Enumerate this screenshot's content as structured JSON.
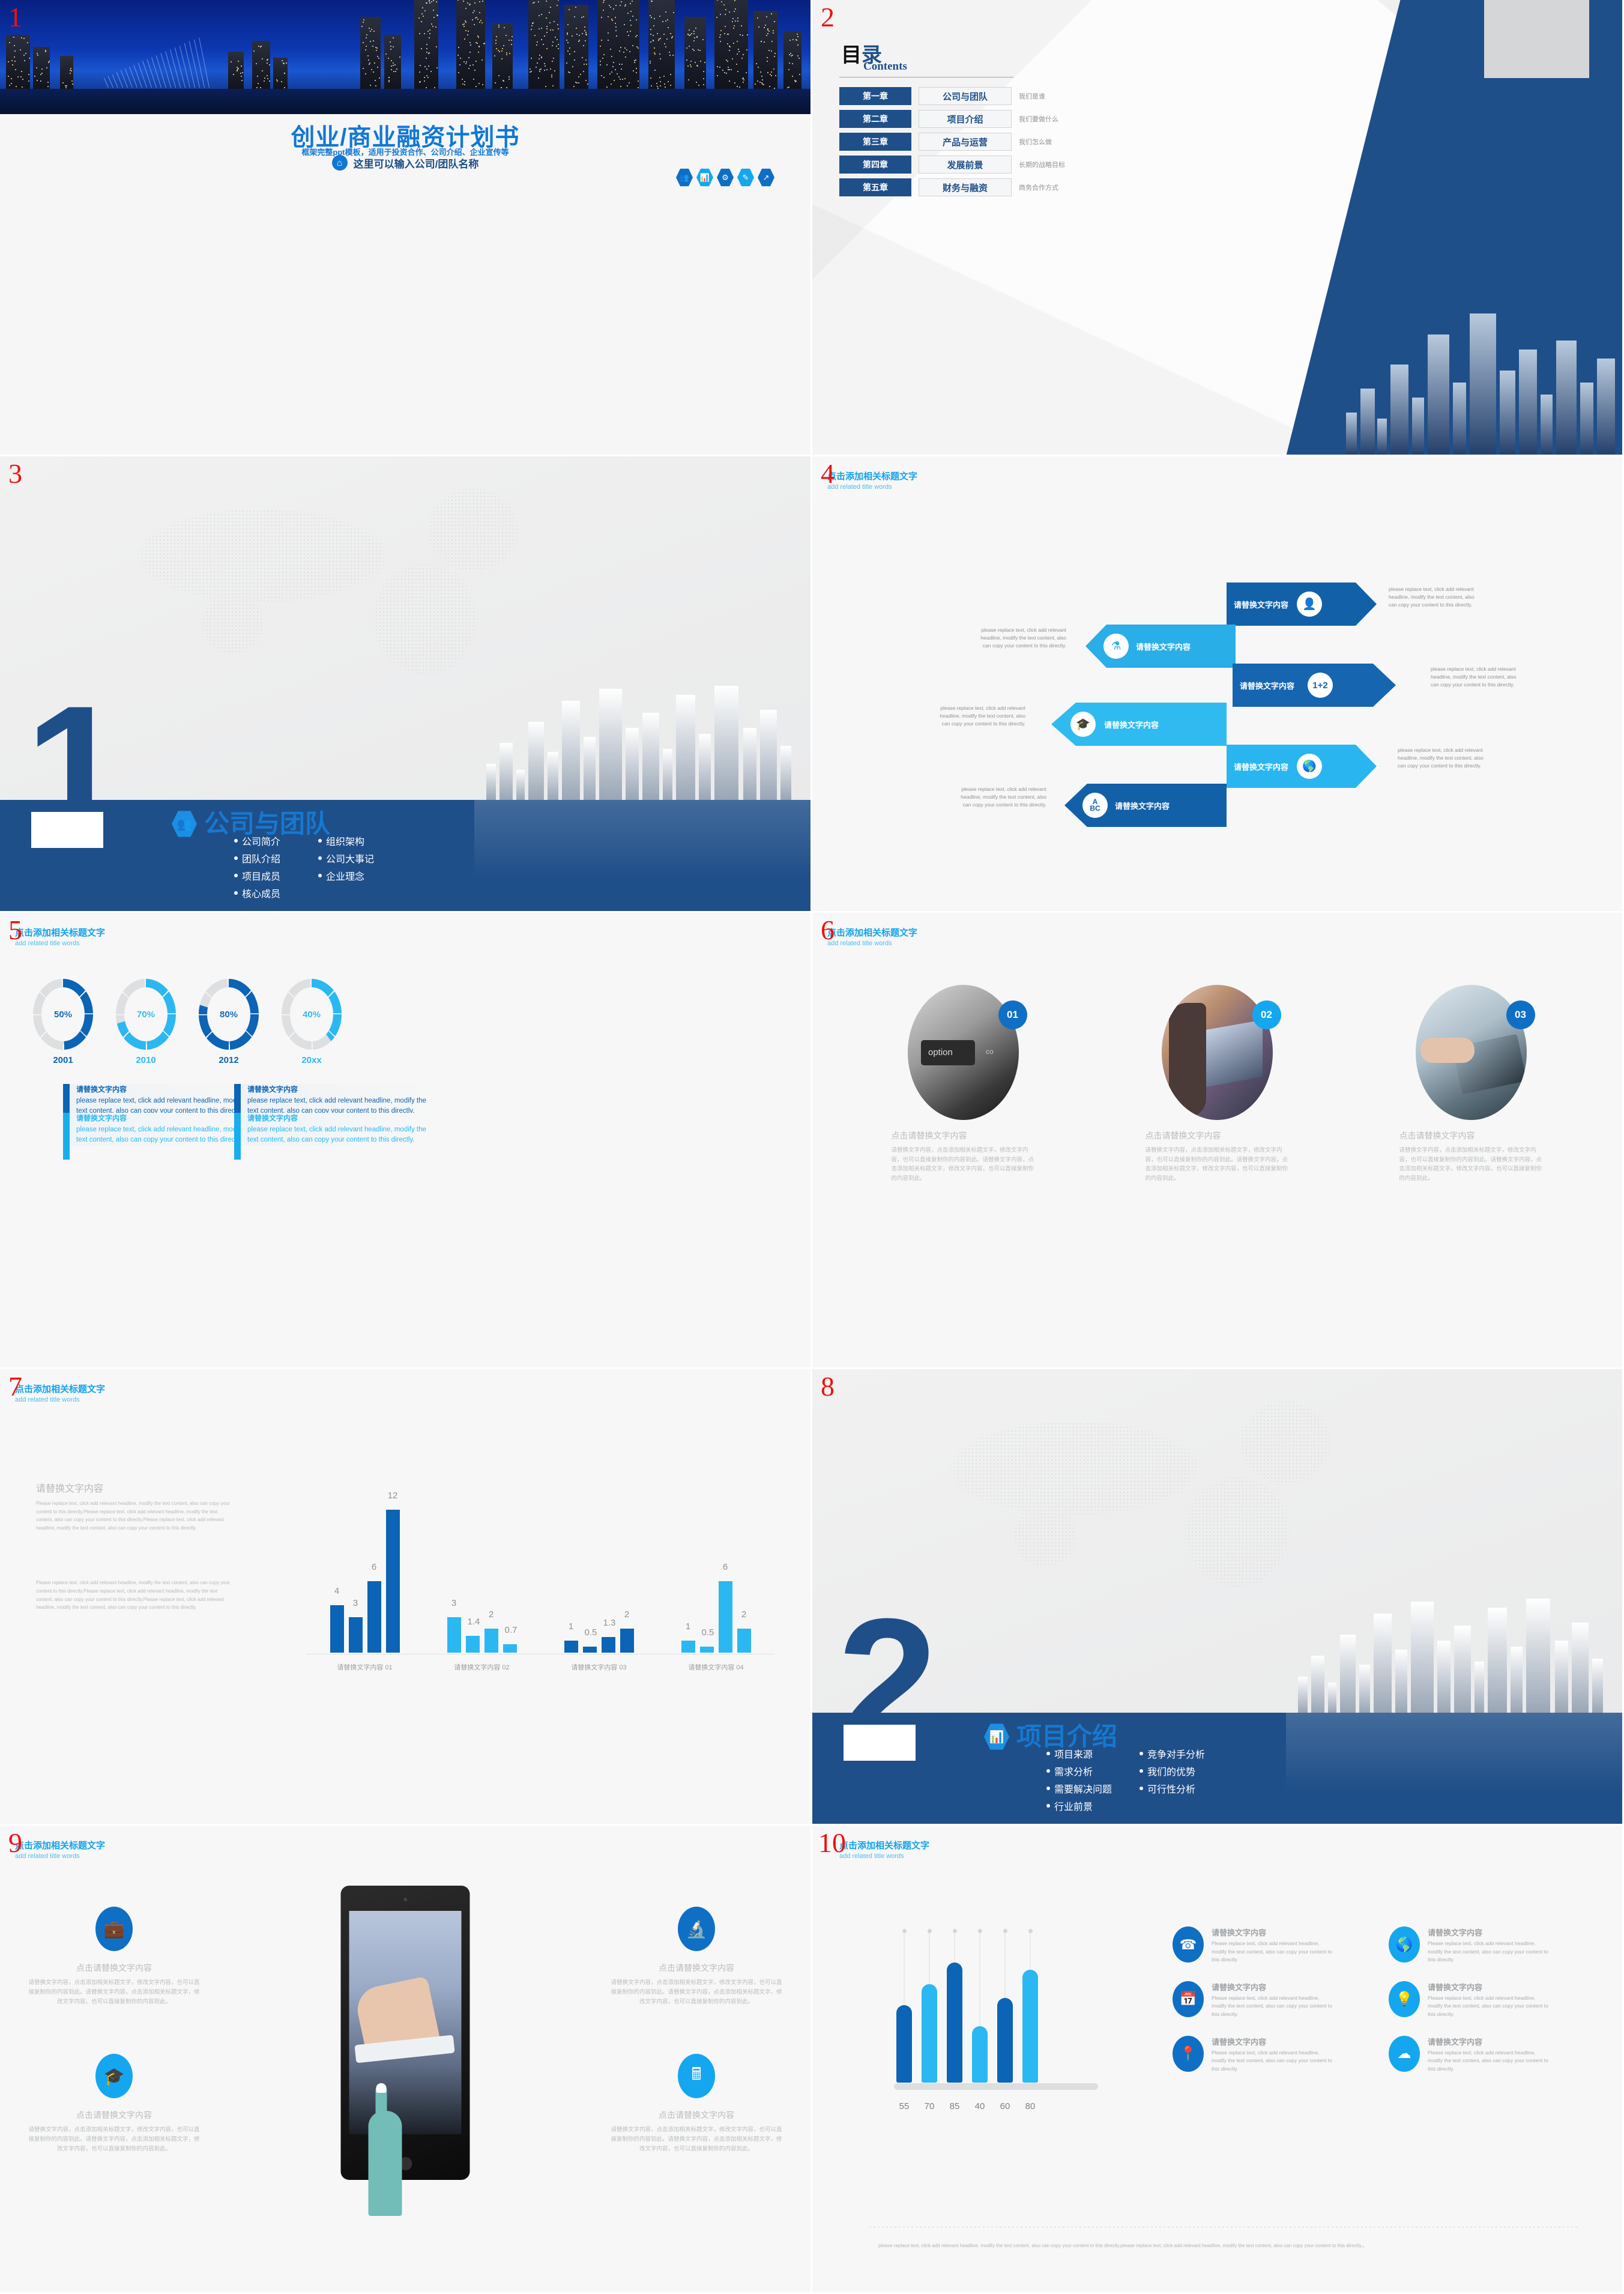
{
  "colors": {
    "dark_blue": "#1f4f89",
    "mid_blue": "#0d6fc4",
    "light_blue": "#14a7ef",
    "accent_cyan": "#13a3ea",
    "slide_number_red": "#ee1111",
    "grey_text": "#b9bcbf"
  },
  "slides": [
    {
      "number": "1",
      "title": "创业/商业融资计划书",
      "subtitle": "框架完整ppt模板，适用于投资合作、公司介绍、企业宣传等",
      "org_placeholder": "这里可以输入公司/团队名称",
      "home_icon": "home-icon",
      "hex_icons": [
        "people-group-icon",
        "presentation-chart-icon",
        "gear-person-icon",
        "document-pen-icon",
        "growth-arrow-icon"
      ]
    },
    {
      "number": "2",
      "heading_cn": "目录",
      "heading_cn_black": "目",
      "heading_cn_blue": "录",
      "heading_en": "Contents",
      "rows": [
        {
          "chapter": "第一章",
          "name": "公司与团队",
          "note": "我们是谁"
        },
        {
          "chapter": "第二章",
          "name": "项目介绍",
          "note": "我们要做什么"
        },
        {
          "chapter": "第三章",
          "name": "产品与运营",
          "note": "我们怎么做"
        },
        {
          "chapter": "第四章",
          "name": "发展前景",
          "note": "长期的战略目标"
        },
        {
          "chapter": "第五章",
          "name": "财务与融资",
          "note": "商务合作方式"
        }
      ]
    },
    {
      "number": "3",
      "big_number": "1",
      "hex_icon": "people-group-icon",
      "section_title": "公司与团队",
      "bullets": [
        "公司简介",
        "组织架构",
        "团队介绍",
        "公司大事记",
        "项目成员",
        "企业理念",
        "核心成员"
      ]
    },
    {
      "number": "4",
      "title_cn": "点击添加相关标题文字",
      "title_en": "add related title words",
      "arrows": [
        {
          "side": "right",
          "color": "#1260a8",
          "label": "请替换文字内容",
          "icon": "person-icon",
          "text": "please replace text, click add relevant headline, modify the text content, also can copy your content to this directly."
        },
        {
          "side": "left",
          "color": "#2aaee8",
          "label": "请替换文字内容",
          "icon": "flask-icon",
          "text": "please replace text, click add relevant headline, modify the text content, also can copy your content to this directly."
        },
        {
          "side": "right",
          "color": "#1565b0",
          "label": "请替换文字内容",
          "icon": "1+2-math-icon",
          "text": "please replace text, click add relevant headline, modify the text content, also can copy your content to this directly."
        },
        {
          "side": "left",
          "color": "#2fbbf0",
          "label": "请替换文字内容",
          "icon": "graduation-cap-icon",
          "text": "please replace text, click add relevant headline, modify the text content, also can copy your content to this directly."
        },
        {
          "side": "right",
          "color": "#29b6f0",
          "label": "请替换文字内容",
          "icon": "globe-trophy-icon",
          "text": "please replace text, click add relevant headline, modify the text content, also can copy your content to this directly."
        },
        {
          "side": "left",
          "color": "#1260a8",
          "label": "请替换文字内容",
          "icon": "abc-icon",
          "text": "please replace text, click add relevant headline, modify the text content, also can copy your content to this directly."
        }
      ]
    },
    {
      "number": "5",
      "title_cn": "点击添加相关标题文字",
      "title_en": "add related title words",
      "text_blocks": [
        {
          "heading": "请替换文字内容",
          "body": "please replace text, click add relevant headline, modify the text content, also can copy your content to this directly.",
          "color": "#0b64b5"
        },
        {
          "heading": "请替换文字内容",
          "body": "please replace text, click add relevant headline, modify the text content, also can copy your content to this directly.",
          "color": "#17aeee"
        },
        {
          "heading": "请替换文字内容",
          "body": "please replace text, click add relevant headline, modify the text content, also can copy your content to this directly.",
          "color": "#0b64b5"
        },
        {
          "heading": "请替换文字内容",
          "body": "please replace text, click add relevant headline, modify the text content, also can copy your content to this directly.",
          "color": "#17aeee"
        }
      ]
    },
    {
      "number": "6",
      "title_cn": "点击添加相关标题文字",
      "title_en": "add related title words",
      "cards": [
        {
          "badge": "01",
          "badge_color": "#0f6fc4",
          "image": "keyboard-option-key-photo",
          "heading": "点击请替换文字内容",
          "body": "请替换文字内容，点击添加相关标题文字，修改文字内容，也可以直接复制你的内容到此。请替换文字内容，点击添加相关标题文字，修改文字内容，也可以直接复制你的内容到此。"
        },
        {
          "badge": "02",
          "badge_color": "#14a7ef",
          "image": "woman-laptop-photo",
          "heading": "点击请替换文字内容",
          "body": "请替换文字内容，点击添加相关标题文字，修改文字内容，也可以直接复制你的内容到此。请替换文字内容，点击添加相关标题文字，修改文字内容，也可以直接复制你的内容到此。"
        },
        {
          "badge": "03",
          "badge_color": "#0f6fc4",
          "image": "hand-tablet-photo",
          "heading": "点击请替换文字内容",
          "body": "请替换文字内容，点击添加相关标题文字，修改文字内容，也可以直接复制你的内容到此。请替换文字内容，点击添加相关标题文字，修改文字内容，也可以直接复制你的内容到此。"
        }
      ]
    },
    {
      "number": "7",
      "title_cn": "点击添加相关标题文字",
      "title_en": "add related title words",
      "left_heading": "请替换文字内容",
      "left_p1": "Please replace text, click add relevant headline, modify the text content, also can copy your content to this directly.Please replace text, click add relevant headline, modify the text content, also can copy your content to this directly.Please replace text, click add relevant headline, modify the text content, also can copy your content to this directly.",
      "left_p2": "Please replace text, click add relevant headline, modify the text content, also can copy your content to this directly.Please replace text, click add relevant headline, modify the text content, also can copy your content to this directly.Please replace text, click add relevant headline, modify the text content, also can copy your content to this directly."
    },
    {
      "number": "8",
      "big_number": "2",
      "hex_icon": "analytics-chart-icon",
      "section_title": "项目介绍",
      "bullets": [
        "项目来源",
        "竞争对手分析",
        "需求分析",
        "我们的优势",
        "需要解决问题",
        "可行性分析",
        "行业前景"
      ]
    },
    {
      "number": "9",
      "title_cn": "点击添加相关标题文字",
      "title_en": "add related title words",
      "cells": [
        {
          "icon": "briefcase-icon",
          "color": "#0f6fc4",
          "heading": "点击请替换文字内容",
          "body": "请替换文字内容，点击添加相关标题文字，修改文字内容，也可以直接复制你的内容到此。请替换文字内容，点击添加相关标题文字，修改文字内容，也可以直接复制你的内容到此。"
        },
        {
          "icon": "microscope-icon",
          "color": "#0f6fc4",
          "heading": "点击请替换文字内容",
          "body": "请替换文字内容，点击添加相关标题文字，修改文字内容，也可以直接复制你的内容到此。请替换文字内容，点击添加相关标题文字，修改文字内容，也可以直接复制你的内容到此。"
        },
        {
          "icon": "graduation-cap-icon",
          "color": "#14a7ef",
          "heading": "点击请替换文字内容",
          "body": "请替换文字内容，点击添加相关标题文字，修改文字内容，也可以直接复制你的内容到此。请替换文字内容，点击添加相关标题文字，修改文字内容，也可以直接复制你的内容到此。"
        },
        {
          "icon": "calculator-icon",
          "color": "#14a7ef",
          "heading": "点击请替换文字内容",
          "body": "请替换文字内容，点击添加相关标题文字，修改文字内容，也可以直接复制你的内容到此。请替换文字内容，点击添加相关标题文字，修改文字内容，也可以直接复制你的内容到此。"
        }
      ],
      "tablet_image": "hand-pointing-tablet-photo",
      "pointer": "pointing-finger-icon"
    },
    {
      "number": "10",
      "title_cn": "点击添加相关标题文字",
      "title_en": "add related title words",
      "features": [
        {
          "icon": "phone-icon",
          "color": "#0f6fc4",
          "heading": "请替换文字内容",
          "body": "Please replace text, click add relevant headline, modify the text content, also can copy your content to this directly."
        },
        {
          "icon": "globe-icon",
          "color": "#14a7ef",
          "heading": "请替换文字内容",
          "body": "Please replace text, click add relevant headline, modify the text content, also can copy your content to this directly."
        },
        {
          "icon": "calendar-icon",
          "color": "#0f6fc4",
          "heading": "请替换文字内容",
          "body": "Please replace text, click add relevant headline, modify the text content, also can copy your content to this directly."
        },
        {
          "icon": "lightbulb-icon",
          "color": "#14a7ef",
          "heading": "请替换文字内容",
          "body": "Please replace text, click add relevant headline, modify the text content, also can copy your content to this directly."
        },
        {
          "icon": "location-pin-icon",
          "color": "#0f6fc4",
          "heading": "请替换文字内容",
          "body": "Please replace text, click add relevant headline, modify the text content, also can copy your content to this directly."
        },
        {
          "icon": "cloud-download-icon",
          "color": "#14a7ef",
          "heading": "请替换文字内容",
          "body": "Please replace text, click add relevant headline, modify the text content, also can copy your content to this directly."
        }
      ],
      "footnote": "please replace text, click add relevant headline, modify the text content, also can copy your content to this directly.please replace text, click add relevant headline, modify the text content, also can copy your content to this directly.。"
    }
  ],
  "chart_data": [
    {
      "id": "slide5_donuts",
      "type": "pie",
      "title": "点击添加相关标题文字",
      "categories": [
        "2001",
        "2010",
        "2012",
        "20xx"
      ],
      "values": [
        50,
        70,
        80,
        40
      ],
      "labels": [
        "50%",
        "70%",
        "80%",
        "40%"
      ],
      "colors": [
        "#0b64b5",
        "#2bb8f2",
        "#0b64b5",
        "#2bb8f2"
      ],
      "track_color": "#dddfe1",
      "ylim": [
        0,
        100
      ]
    },
    {
      "id": "slide7_bars",
      "type": "bar",
      "title": "请替换文字内容",
      "categories": [
        "请替换文字内容 01",
        "请替换文字内容 02",
        "请替换文字内容 03",
        "请替换文字内容 04"
      ],
      "groups": [
        {
          "category": "请替换文字内容 01",
          "color": "#0b64b5",
          "values": [
            4,
            3,
            6,
            12
          ],
          "labels": [
            "4",
            "3",
            "6",
            "12"
          ]
        },
        {
          "category": "请替换文字内容 02",
          "color": "#2bb8f2",
          "values": [
            3,
            1.4,
            2,
            0.7
          ],
          "labels": [
            "3",
            "1.4",
            "2",
            "0.7"
          ]
        },
        {
          "category": "请替换文字内容 03",
          "color": "#0b64b5",
          "values": [
            1,
            0.5,
            1.3,
            2
          ],
          "labels": [
            "1",
            "0.5",
            "1.3",
            "2"
          ]
        },
        {
          "category": "请替换文字内容 04",
          "color": "#2bb8f2",
          "values": [
            1,
            0.5,
            6,
            2
          ],
          "labels": [
            "1",
            "0.5",
            "6",
            "2"
          ]
        }
      ],
      "xlabel": "",
      "ylabel": "",
      "grid": false,
      "legend": "none",
      "ylim": [
        0,
        12
      ]
    },
    {
      "id": "slide10_bars",
      "type": "bar",
      "title": "点击添加相关标题文字",
      "categories": [
        "55",
        "70",
        "85",
        "40",
        "60",
        "80"
      ],
      "values": [
        55,
        70,
        85,
        40,
        60,
        80
      ],
      "colors": [
        "#0b64b5",
        "#2bb8f2",
        "#0b64b5",
        "#2bb8f2",
        "#0b64b5",
        "#2bb8f2"
      ],
      "xlabel": "",
      "ylabel": "",
      "grid": false,
      "legend": "none",
      "ylim": [
        0,
        100
      ]
    }
  ]
}
